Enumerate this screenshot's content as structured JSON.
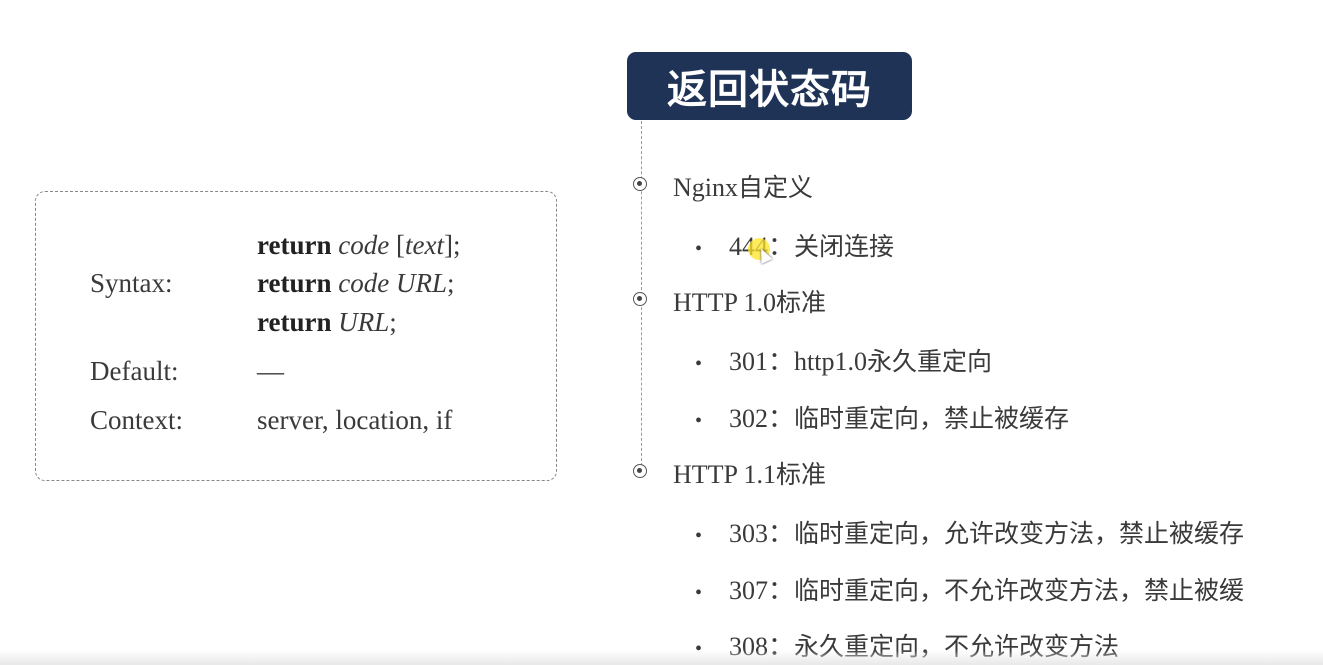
{
  "title": "返回状态码",
  "syntax": {
    "syntax_label": "Syntax:",
    "default_label": "Default:",
    "context_label": "Context:",
    "lines": [
      {
        "kw": "return",
        "arg1": "code",
        "arg2_open": " [",
        "arg2": "text",
        "arg2_close": "];"
      },
      {
        "kw": "return",
        "arg1": "code",
        "arg2": "URL",
        "end": ";"
      },
      {
        "kw": "return",
        "arg1": "URL",
        "end": ";"
      }
    ],
    "default_value": "—",
    "context_value": "server, location, if"
  },
  "outline": {
    "sections": [
      {
        "prefix": "Nginx",
        "suffix": "自定义",
        "items": [
          {
            "code": "444",
            "sep": "：",
            "desc": "关闭连接"
          }
        ]
      },
      {
        "prefix": "HTTP 1.0",
        "suffix": "标准",
        "items": [
          {
            "code": "301",
            "sep": "：",
            "desc_prefix": "http1.0",
            "desc": "永久重定向"
          },
          {
            "code": "302",
            "sep": "：",
            "desc": "临时重定向，禁止被缓存"
          }
        ]
      },
      {
        "prefix": "HTTP 1.1",
        "suffix": "标准",
        "items": [
          {
            "code": "303",
            "sep": "：",
            "desc": "临时重定向，允许改变方法，禁止被缓存"
          },
          {
            "code": "307",
            "sep": "：",
            "desc": "临时重定向，不允许改变方法，禁止被缓"
          },
          {
            "code": "308",
            "sep": "：",
            "desc": "永久重定向，不允许改变方法"
          }
        ]
      }
    ]
  },
  "colors": {
    "title_bg": "#1f3357",
    "title_text": "#ffffff",
    "text": "#3a3a3a",
    "highlight": "#ffe628"
  }
}
